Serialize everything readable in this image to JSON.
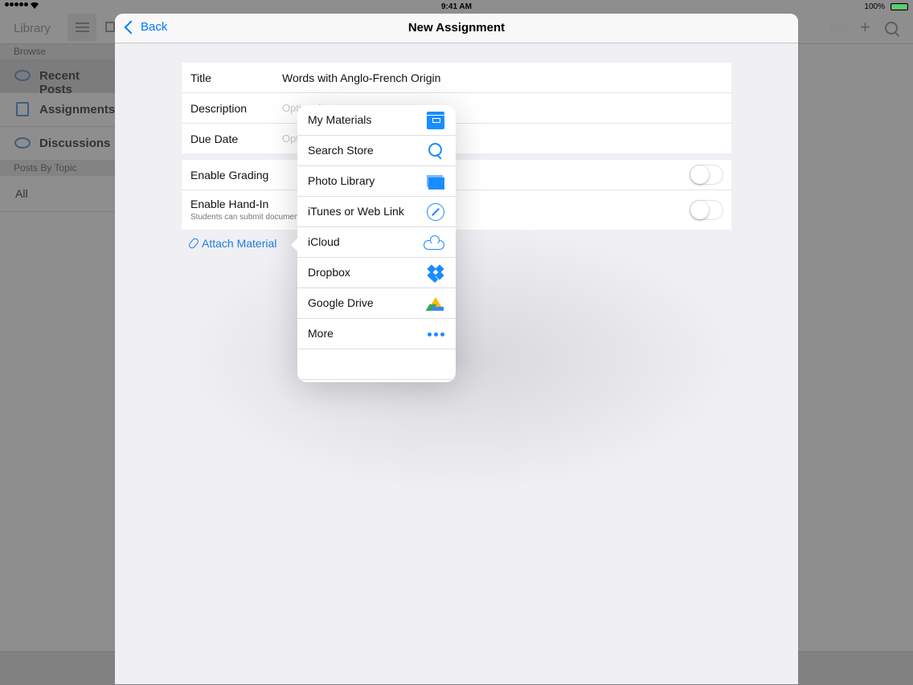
{
  "status": {
    "time": "9:41 AM",
    "battery": "100%",
    "battery_level": 1.0
  },
  "background": {
    "nav": {
      "library_label": "Library",
      "edit_label": "Edit",
      "plus_label": "+"
    },
    "sidebar": {
      "browse_header": "Browse",
      "items": [
        {
          "label": "Recent Posts",
          "icon": "speech-bubble-icon"
        },
        {
          "label": "Assignments",
          "icon": "list-icon"
        },
        {
          "label": "Discussions",
          "icon": "speech-bubbles-icon"
        }
      ],
      "topic_header": "Posts By Topic",
      "all_label": "All"
    }
  },
  "modal": {
    "back_label": "Back",
    "title": "New Assignment",
    "fields": {
      "title_label": "Title",
      "title_value": "Words with Anglo-French Origin",
      "description_label": "Description",
      "description_placeholder": "Optional",
      "due_label": "Due Date",
      "due_placeholder": "Optional"
    },
    "settings": {
      "grading_label": "Enable Grading",
      "grading_on": false,
      "handin_label": "Enable Hand-In",
      "handin_sub": "Students can submit documents",
      "handin_on": false
    },
    "attach_label": "Attach Material"
  },
  "popover": {
    "items": [
      {
        "label": "My Materials",
        "icon": "archive-box-icon"
      },
      {
        "label": "Search Store",
        "icon": "search-icon"
      },
      {
        "label": "Photo Library",
        "icon": "photo-stack-icon"
      },
      {
        "label": "iTunes or Web Link",
        "icon": "compass-icon"
      },
      {
        "label": "iCloud",
        "icon": "cloud-icon"
      },
      {
        "label": "Dropbox",
        "icon": "dropbox-icon"
      },
      {
        "label": "Google Drive",
        "icon": "google-drive-icon"
      },
      {
        "label": "More",
        "icon": "more-dots-icon"
      }
    ]
  },
  "colors": {
    "accent": "#007aff",
    "icon_blue": "#1a8cff",
    "dim_overlay": "#8e8e8e"
  }
}
